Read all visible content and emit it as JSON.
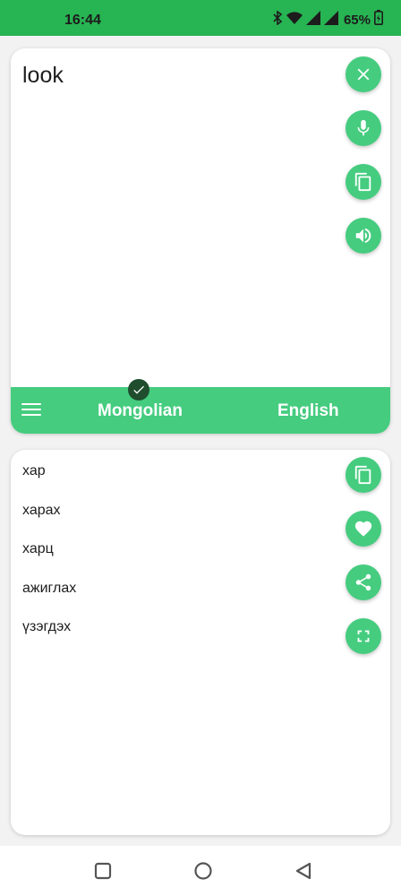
{
  "status_bar": {
    "time": "16:44",
    "battery": "65%"
  },
  "input": {
    "text": "look"
  },
  "language_bar": {
    "source": "Mongolian",
    "target": "English"
  },
  "results": [
    {
      "text": "хар"
    },
    {
      "text": "харах"
    },
    {
      "text": "харц"
    },
    {
      "text": "ажиглах"
    },
    {
      "text": "үзэгдэх"
    }
  ],
  "colors": {
    "status_bar": "#27b452",
    "accent": "#45cc7f",
    "badge": "#1f4d2e"
  }
}
